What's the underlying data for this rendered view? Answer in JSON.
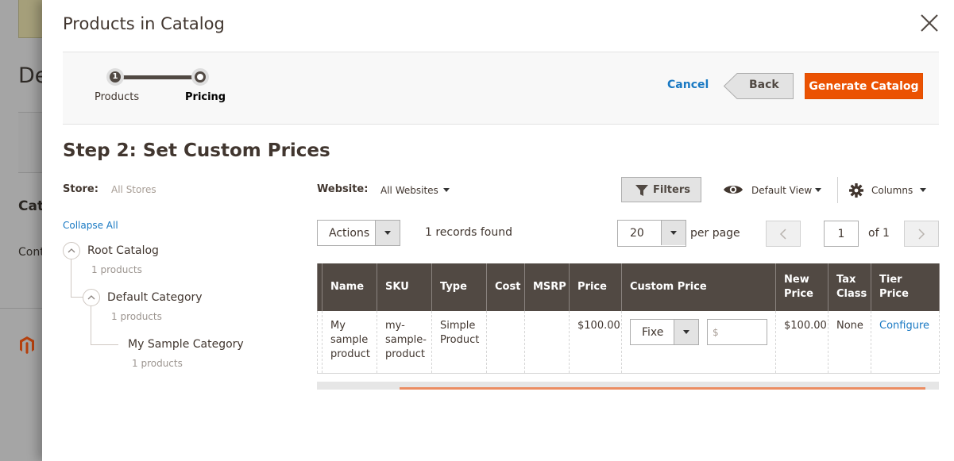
{
  "background": {
    "title_fragment": "De",
    "section_fragment": "Cat",
    "content_fragment": "Cont",
    "logo": "magento-logo-icon"
  },
  "modal": {
    "title": "Products in Catalog",
    "close_icon": "close-icon"
  },
  "wizard": {
    "steps": [
      {
        "number": "1",
        "label": "Products",
        "state": "completed"
      },
      {
        "number": "",
        "label": "Pricing",
        "state": "active"
      }
    ],
    "cancel_label": "Cancel",
    "back_label": "Back",
    "generate_label": "Generate Catalog"
  },
  "step": {
    "title": "Step 2: Set Custom Prices",
    "store_label": "Store:",
    "store_value": "All Stores",
    "collapse_all": "Collapse All"
  },
  "tree": [
    {
      "name": "Root Catalog",
      "count": "1 products",
      "expanded": true
    },
    {
      "name": "Default Category",
      "count": "1 products",
      "expanded": true
    },
    {
      "name": "My Sample Category",
      "count": "1 products",
      "expanded": false
    }
  ],
  "toolbar": {
    "website_label": "Website:",
    "website_value": "All Websites",
    "filters_label": "Filters",
    "view_label": "Default View",
    "columns_label": "Columns",
    "actions_label": "Actions",
    "records_found": "1 records found",
    "per_page_value": "20",
    "per_page_label": "per page",
    "current_page": "1",
    "total_pages_label": "of 1"
  },
  "grid": {
    "columns": [
      "Name",
      "SKU",
      "Type",
      "Cost",
      "MSRP",
      "Price",
      "Custom Price",
      "New Price",
      "Tax Class",
      "Tier Price"
    ],
    "rows": [
      {
        "name": "My sample product",
        "sku": "my-sample-product",
        "type": "Simple Product",
        "cost": "",
        "msrp": "",
        "price": "$100.00",
        "custom_price_type": "Fixe",
        "custom_price_placeholder": "$",
        "custom_price_value": "",
        "new_price": "$100.00",
        "tax_class": "None",
        "tier_price": "Configure"
      }
    ]
  },
  "colors": {
    "accent": "#eb5202",
    "link": "#1979c3",
    "header_bg": "#514943",
    "scroll_thumb": "#eb8c62"
  }
}
